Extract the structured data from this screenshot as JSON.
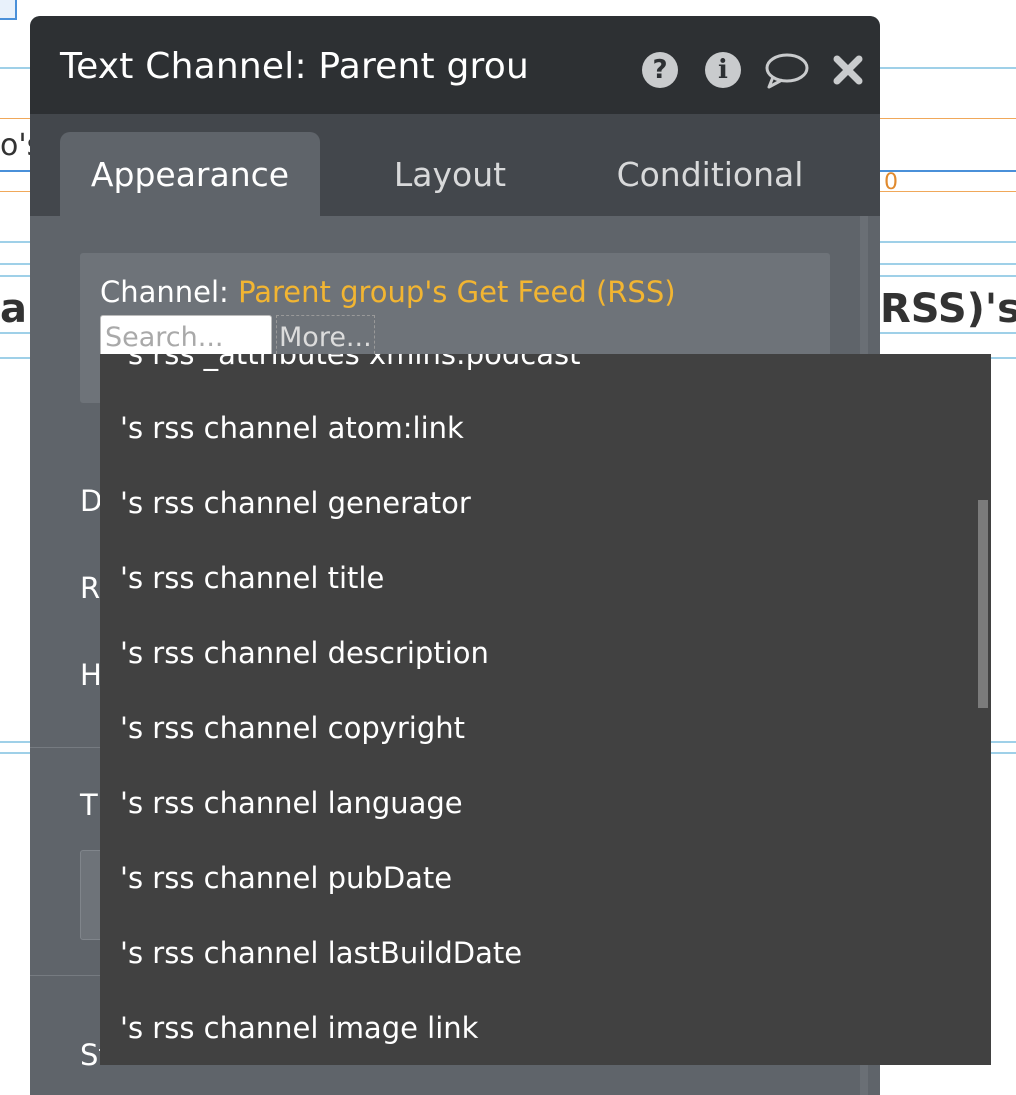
{
  "background": {
    "left_snippet": "o's",
    "left_heading_fragment": "ar",
    "right_heading_fragment": "RSS)'s",
    "right_number": "0"
  },
  "panel": {
    "title": "Text Channel: Parent grou",
    "icons": [
      "help-icon",
      "info-icon",
      "comment-icon",
      "close-icon"
    ],
    "tabs": [
      {
        "label": "Appearance",
        "active": true
      },
      {
        "label": "Layout",
        "active": false
      },
      {
        "label": "Conditional",
        "active": false
      }
    ],
    "field": {
      "label": "Channel:",
      "value": "Parent group's Get Feed (RSS)",
      "search_placeholder": "Search...",
      "more_label": "More..."
    },
    "hidden_labels": [
      "D",
      "R",
      "H",
      "T",
      "St"
    ]
  },
  "dropdown": {
    "items": [
      "'s rss _attributes xmlns:podcast",
      "'s rss channel atom:link",
      "'s rss channel generator",
      "'s rss channel title",
      "'s rss channel description",
      "'s rss channel copyright",
      "'s rss channel language",
      "'s rss channel pubDate",
      "'s rss channel lastBuildDate",
      "'s rss channel image link"
    ]
  },
  "colors": {
    "header_bg": "#2d3033",
    "panel_bg": "#5f646a",
    "accent_value": "#f2b532",
    "dropdown_bg": "#414141"
  }
}
